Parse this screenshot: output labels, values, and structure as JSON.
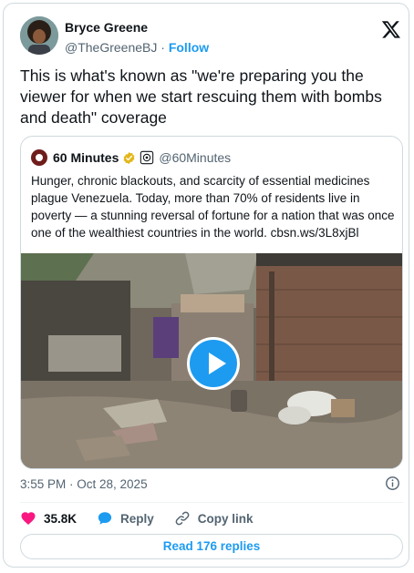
{
  "author": {
    "name": "Bryce Greene",
    "handle": "@TheGreeneBJ",
    "separator": "·",
    "follow_label": "Follow"
  },
  "tweet": {
    "text": "This is what's known as \"we're preparing you the viewer for when we start rescuing them with bombs and death\" coverage",
    "timestamp": "3:55 PM · Oct 28, 2025"
  },
  "quoted": {
    "name": "60 Minutes",
    "handle": "@60Minutes",
    "text": "Hunger, chronic blackouts, and scarcity of essential medicines plague Venezuela. Today, more than 70% of residents live in poverty — a stunning reversal of fortune for a nation that was once one of the wealthiest countries in the world. cbsn.ws/3L8xjBl",
    "media_type": "video"
  },
  "actions": {
    "likes": "35.8K",
    "reply_label": "Reply",
    "copy_link_label": "Copy link",
    "read_replies_label": "Read 176 replies"
  },
  "colors": {
    "accent": "#1d9bf0",
    "like": "#f91880",
    "text": "#0f1419",
    "muted": "#536471",
    "border": "#cfd9de"
  },
  "icons": [
    "x-logo-icon",
    "verified-badge-icon",
    "affiliate-badge-icon",
    "play-icon",
    "info-icon",
    "heart-icon",
    "reply-icon",
    "link-icon"
  ]
}
